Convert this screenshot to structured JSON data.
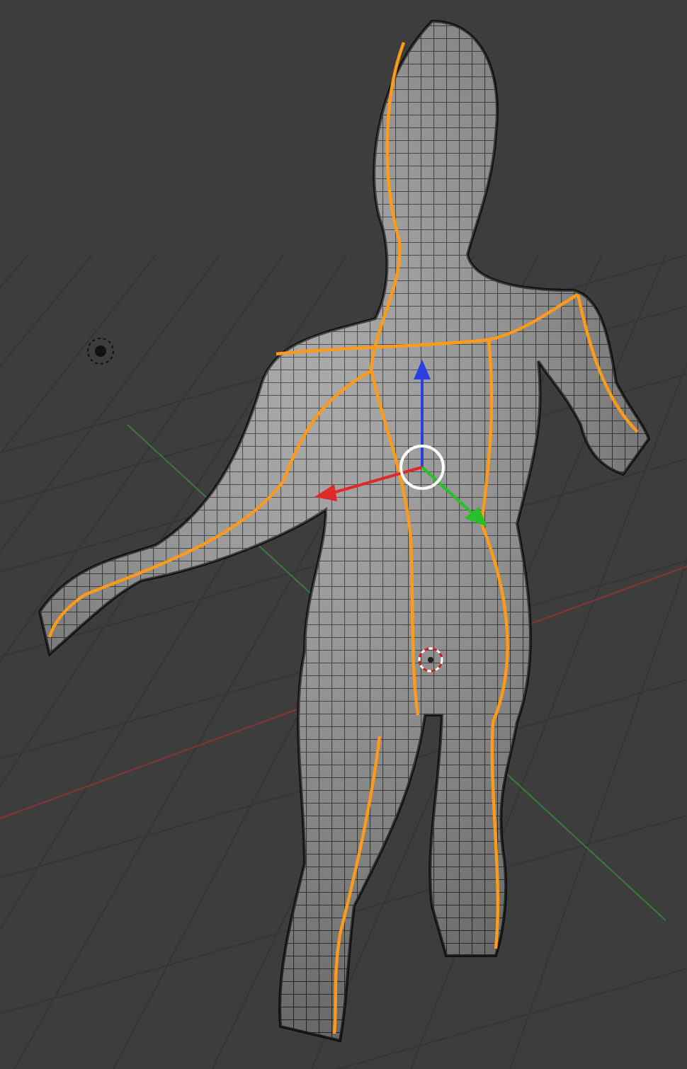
{
  "mesh": {
    "seams_marked": true
  }
}
